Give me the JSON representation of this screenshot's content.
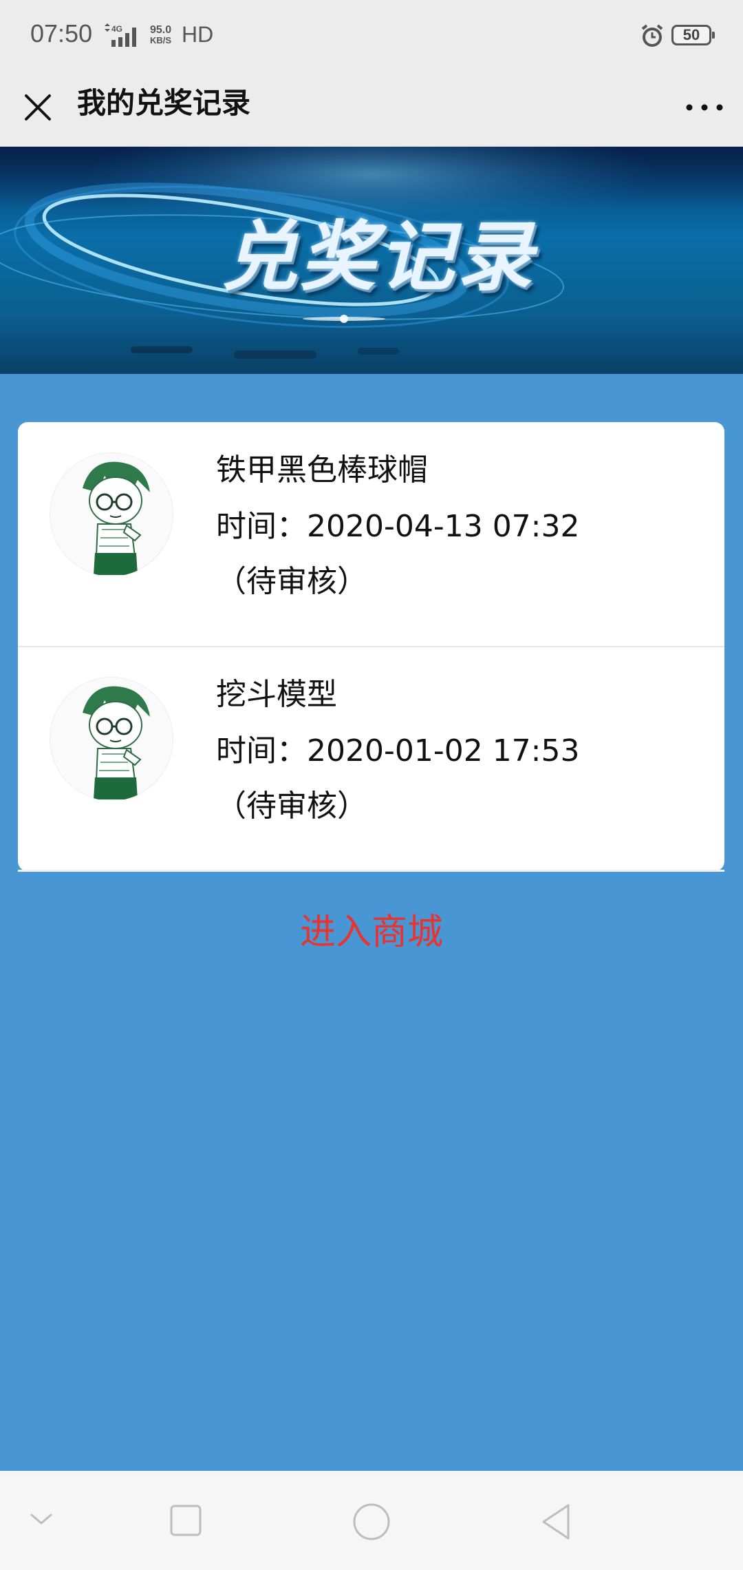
{
  "status_bar": {
    "time": "07:50",
    "network": "4G",
    "speed_value": "95.0",
    "speed_unit": "KB/S",
    "hd": "HD",
    "battery": "50",
    "icons": [
      "signal-icon",
      "alarm-icon",
      "battery-icon"
    ]
  },
  "header": {
    "title": "我的兑奖记录",
    "close_icon": "close-icon",
    "more_icon": "more-icon"
  },
  "banner": {
    "title": "兑奖记录"
  },
  "records": [
    {
      "name": "铁甲黑色棒球帽",
      "time": "时间：2020-04-13 07:32",
      "status": "（待审核）"
    },
    {
      "name": "挖斗模型",
      "time": "时间：2020-01-02 17:53",
      "status": "（待审核）"
    }
  ],
  "footer_link": {
    "label": "进入商城"
  },
  "navigation": {
    "icons": [
      "collapse-icon",
      "recent-apps-icon",
      "home-icon",
      "back-icon"
    ]
  },
  "colors": {
    "page_background": "#4897d4",
    "link_red": "#e8332f",
    "header_background": "#ececec"
  }
}
